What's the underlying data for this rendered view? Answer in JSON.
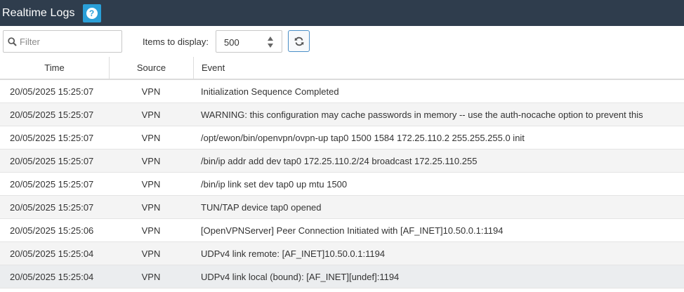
{
  "header": {
    "title": "Realtime Logs",
    "help_icon": "question-circle-icon",
    "help_glyph": "?",
    "bg_color": "#2f3d4d",
    "help_color": "#2a9fd8"
  },
  "toolbar": {
    "filter_placeholder": "Filter",
    "filter_icon": "search-icon",
    "items_label": "Items to display:",
    "items_value": "500",
    "refresh_icon": "refresh-icon"
  },
  "table": {
    "columns": [
      "Time",
      "Source",
      "Event"
    ],
    "rows": [
      {
        "time": "20/05/2025 15:25:07",
        "source": "VPN",
        "event": "Initialization Sequence Completed"
      },
      {
        "time": "20/05/2025 15:25:07",
        "source": "VPN",
        "event": "WARNING: this configuration may cache passwords in memory -- use the auth-nocache option to prevent this"
      },
      {
        "time": "20/05/2025 15:25:07",
        "source": "VPN",
        "event": "/opt/ewon/bin/openvpn/ovpn-up tap0 1500 1584 172.25.110.2 255.255.255.0 init"
      },
      {
        "time": "20/05/2025 15:25:07",
        "source": "VPN",
        "event": "/bin/ip addr add dev tap0 172.25.110.2/24 broadcast 172.25.110.255"
      },
      {
        "time": "20/05/2025 15:25:07",
        "source": "VPN",
        "event": "/bin/ip link set dev tap0 up mtu 1500"
      },
      {
        "time": "20/05/2025 15:25:07",
        "source": "VPN",
        "event": "TUN/TAP device tap0 opened"
      },
      {
        "time": "20/05/2025 15:25:06",
        "source": "VPN",
        "event": "[OpenVPNServer] Peer Connection Initiated with [AF_INET]10.50.0.1:1194"
      },
      {
        "time": "20/05/2025 15:25:04",
        "source": "VPN",
        "event": "UDPv4 link remote: [AF_INET]10.50.0.1:1194"
      },
      {
        "time": "20/05/2025 15:25:04",
        "source": "VPN",
        "event": "UDPv4 link local (bound): [AF_INET][undef]:1194"
      }
    ]
  }
}
